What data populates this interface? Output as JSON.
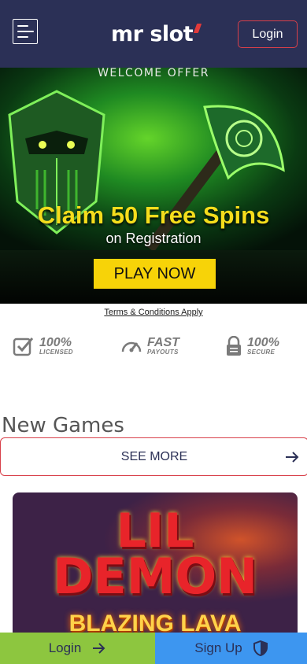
{
  "header": {
    "logo_text": "mr slot",
    "login_label": "Login",
    "menu_icon": "hamburger-menu-icon"
  },
  "hero": {
    "title": "WELCOME OFFER",
    "headline": "Claim 50 Free Spins",
    "subline": "on Registration",
    "cta_label": "PLAY NOW"
  },
  "terms_link": "Terms & Conditions Apply",
  "badges": [
    {
      "big": "100%",
      "small": "LICENSED",
      "icon": "check-square-icon"
    },
    {
      "big": "FAST",
      "small": "PAYOUTS",
      "icon": "speedometer-icon"
    },
    {
      "big": "100%",
      "small": "SECURE",
      "icon": "padlock-icon"
    }
  ],
  "new_games": {
    "title": "New Games",
    "see_more_label": "SEE MORE",
    "featured_game": {
      "line1": "LIL",
      "line2": "DEMON",
      "line3": "BLAZING LAVA"
    }
  },
  "bottom_bar": {
    "login_label": "Login",
    "signup_label": "Sign Up"
  },
  "colors": {
    "header_bg": "#2b3056",
    "accent_red": "#d8404a",
    "cta_yellow": "#f7d308",
    "login_green": "#8dc63f",
    "signup_blue": "#3d96f0"
  }
}
